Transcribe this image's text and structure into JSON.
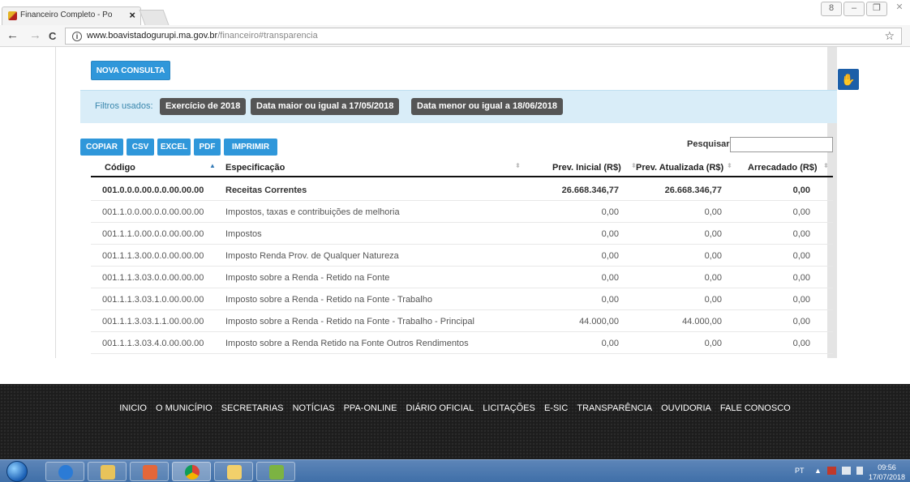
{
  "browser": {
    "tab_title": "Financeiro Completo - Po",
    "tab_close": "×",
    "url_host": "www.boavistadogurupi.ma.gov.br",
    "url_path": "/financeiro#transparencia",
    "back_icon": "←",
    "forward_icon": "→",
    "reload_icon": "C",
    "info_icon": "i",
    "star_icon": "☆",
    "window_controls": [
      "8",
      "–",
      "❐",
      "✕"
    ]
  },
  "page": {
    "nova_consulta": "NOVA CONSULTA",
    "filtros_label": "Filtros usados:",
    "filters": [
      "Exercício de 2018",
      "Data maior ou igual a 17/05/2018",
      "Data menor ou igual a 18/06/2018"
    ],
    "export_buttons": [
      "COPIAR",
      "CSV",
      "EXCEL",
      "PDF",
      "IMPRIMIR"
    ],
    "search_label": "Pesquisar",
    "search_value": "",
    "libras_icon": "✋",
    "table": {
      "headers": [
        "Código",
        "Especificação",
        "Prev. Inicial (R$)",
        "Prev. Atualizada (R$)",
        "Arrecadado (R$)"
      ],
      "rows": [
        {
          "codigo": "001.0.0.0.00.0.0.00.00.00",
          "especificacao": "Receitas Correntes",
          "prev_inicial": "26.668.346,77",
          "prev_atualizada": "26.668.346,77",
          "arrecadado": "0,00"
        },
        {
          "codigo": "001.1.0.0.00.0.0.00.00.00",
          "especificacao": "Impostos, taxas e contribuições de melhoria",
          "prev_inicial": "0,00",
          "prev_atualizada": "0,00",
          "arrecadado": "0,00"
        },
        {
          "codigo": "001.1.1.0.00.0.0.00.00.00",
          "especificacao": "Impostos",
          "prev_inicial": "0,00",
          "prev_atualizada": "0,00",
          "arrecadado": "0,00"
        },
        {
          "codigo": "001.1.1.3.00.0.0.00.00.00",
          "especificacao": "Imposto Renda Prov. de Qualquer Natureza",
          "prev_inicial": "0,00",
          "prev_atualizada": "0,00",
          "arrecadado": "0,00"
        },
        {
          "codigo": "001.1.1.3.03.0.0.00.00.00",
          "especificacao": "Imposto sobre a Renda - Retido na Fonte",
          "prev_inicial": "0,00",
          "prev_atualizada": "0,00",
          "arrecadado": "0,00"
        },
        {
          "codigo": "001.1.1.3.03.1.0.00.00.00",
          "especificacao": "Imposto sobre a Renda - Retido na Fonte - Trabalho",
          "prev_inicial": "0,00",
          "prev_atualizada": "0,00",
          "arrecadado": "0,00"
        },
        {
          "codigo": "001.1.1.3.03.1.1.00.00.00",
          "especificacao": "Imposto sobre a Renda - Retido na Fonte - Trabalho - Principal",
          "prev_inicial": "44.000,00",
          "prev_atualizada": "44.000,00",
          "arrecadado": "0,00"
        },
        {
          "codigo": "001.1.1.3.03.4.0.00.00.00",
          "especificacao": "Imposto sobre a Renda Retido na Fonte Outros Rendimentos",
          "prev_inicial": "0,00",
          "prev_atualizada": "0,00",
          "arrecadado": "0,00"
        }
      ]
    }
  },
  "footer_nav": [
    "INICIO",
    "O MUNICÍPIO",
    "SECRETARIAS",
    "NOTÍCIAS",
    "PPA-ONLINE",
    "DIÁRIO OFICIAL",
    "LICITAÇÕES",
    "E-SIC",
    "TRANSPARÊNCIA",
    "OUVIDORIA",
    "FALE CONOSCO"
  ],
  "taskbar": {
    "language": "PT",
    "tray_arrow": "▲",
    "time": "09:56",
    "date": "17/07/2018"
  }
}
